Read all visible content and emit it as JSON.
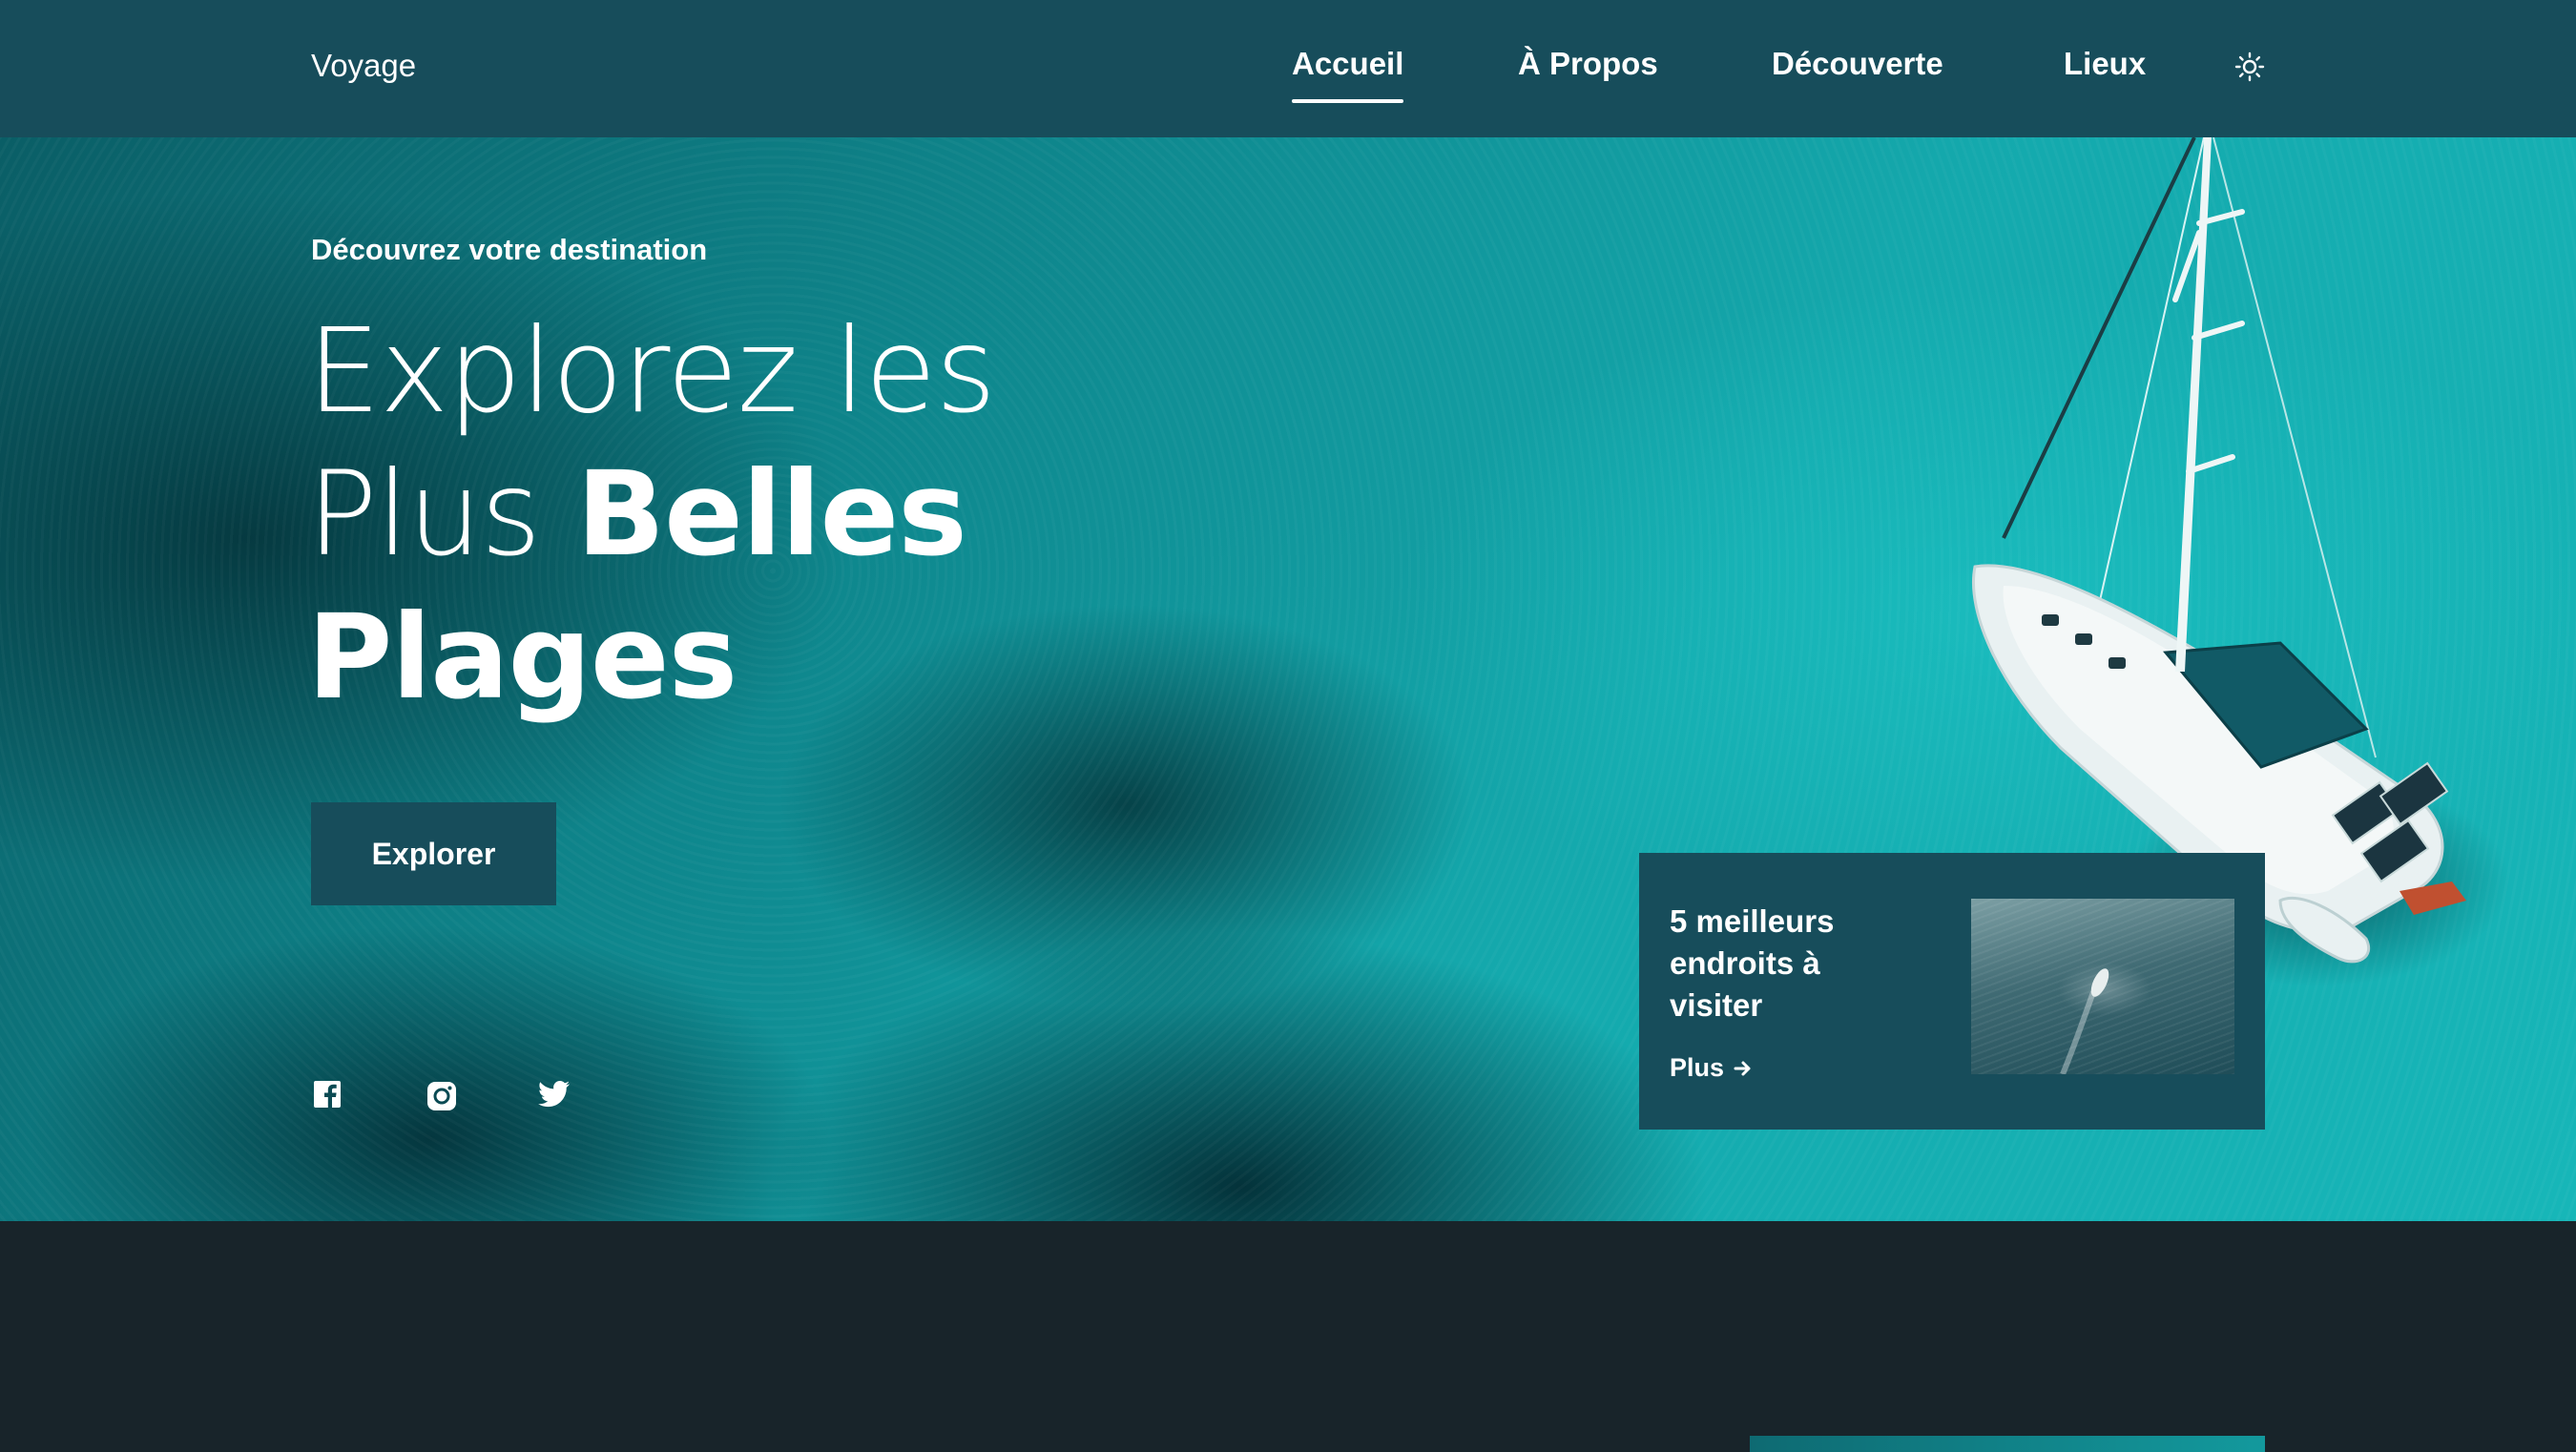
{
  "header": {
    "logo": "Voyage",
    "nav": [
      {
        "label": "Accueil",
        "active": true
      },
      {
        "label": "À Propos",
        "active": false
      },
      {
        "label": "Découverte",
        "active": false
      },
      {
        "label": "Lieux",
        "active": false
      }
    ],
    "theme_icon": "sun-icon"
  },
  "hero": {
    "subtitle": "Découvrez votre destination",
    "title_line1": "Explorez les",
    "title_line2_light": "Plus ",
    "title_line2_bold": "Belles",
    "title_line3": "Plages",
    "button": "Explorer",
    "socials": [
      "facebook-icon",
      "instagram-icon",
      "twitter-icon"
    ]
  },
  "card": {
    "title": "5 meilleurs endroits à visiter",
    "more": "Plus",
    "more_icon": "arrow-right-icon"
  },
  "colors": {
    "header_bg": "#174d5b",
    "page_bg": "#18242a",
    "accent": "#13a9ad"
  }
}
